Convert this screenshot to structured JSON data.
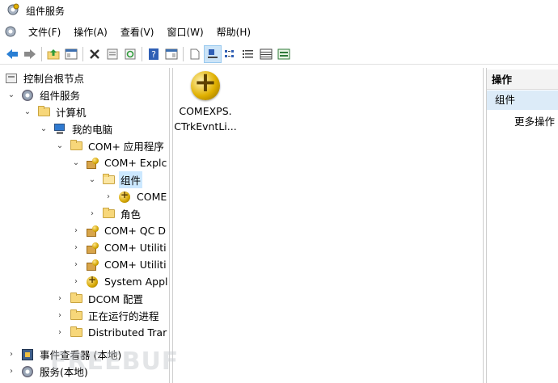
{
  "window": {
    "title": "组件服务"
  },
  "menu": {
    "items": [
      {
        "label": "文件(F)"
      },
      {
        "label": "操作(A)"
      },
      {
        "label": "查看(V)"
      },
      {
        "label": "窗口(W)"
      },
      {
        "label": "帮助(H)"
      }
    ]
  },
  "toolbar": {
    "buttons": [
      "back-icon",
      "forward-icon",
      "up-folder-icon",
      "show-hide-tree-icon",
      "delete-icon",
      "properties-icon",
      "refresh-icon",
      "help-icon",
      "show-hide-action-pane-icon",
      "export-list-icon",
      "large-icons-view-icon",
      "small-icons-view-icon",
      "list-view-icon",
      "details-view-icon",
      "status-view-icon"
    ]
  },
  "tree": {
    "items": [
      {
        "label": "控制台根节点"
      },
      {
        "label": "组件服务"
      },
      {
        "label": "计算机"
      },
      {
        "label": "我的电脑"
      },
      {
        "label": "COM+ 应用程序"
      },
      {
        "label": "COM+ Explc"
      },
      {
        "label": "组件"
      },
      {
        "label": "COME"
      },
      {
        "label": "角色"
      },
      {
        "label": "COM+ QC D"
      },
      {
        "label": "COM+ Utiliti"
      },
      {
        "label": "COM+ Utiliti"
      },
      {
        "label": "System Appl"
      },
      {
        "label": "DCOM 配置"
      },
      {
        "label": "正在运行的进程"
      },
      {
        "label": "Distributed Trar"
      },
      {
        "label": "事件查看器 (本地)"
      },
      {
        "label": "服务(本地)"
      }
    ]
  },
  "content": {
    "items": [
      {
        "label_line1": "COMEXPS.",
        "label_line2": "CTrkEvntLi..."
      }
    ]
  },
  "actions": {
    "header": "操作",
    "group": "组件",
    "more": "更多操作"
  },
  "watermark": "FREEBUF"
}
